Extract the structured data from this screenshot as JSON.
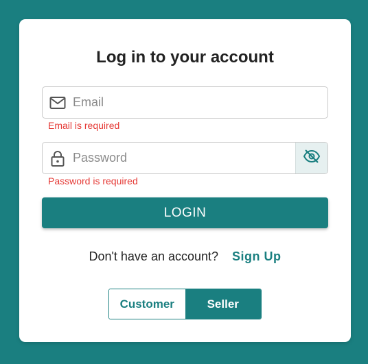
{
  "form": {
    "title": "Log in to your account",
    "email": {
      "placeholder": "Email",
      "value": "",
      "icon": "mail-icon",
      "error": "Email is required"
    },
    "password": {
      "placeholder": "Password",
      "value": "",
      "icon": "lock-icon",
      "toggle_icon": "eye-off-icon",
      "error": "Password is required"
    },
    "login_label": "LOGIN",
    "signup_prompt": "Don't have an account?",
    "signup_link": "Sign Up"
  },
  "role_toggle": {
    "options": [
      "Customer",
      "Seller"
    ],
    "selected": "Seller"
  },
  "colors": {
    "accent": "#1a7f80",
    "error": "#e53935",
    "background": "#1a7f80",
    "card": "#ffffff"
  }
}
